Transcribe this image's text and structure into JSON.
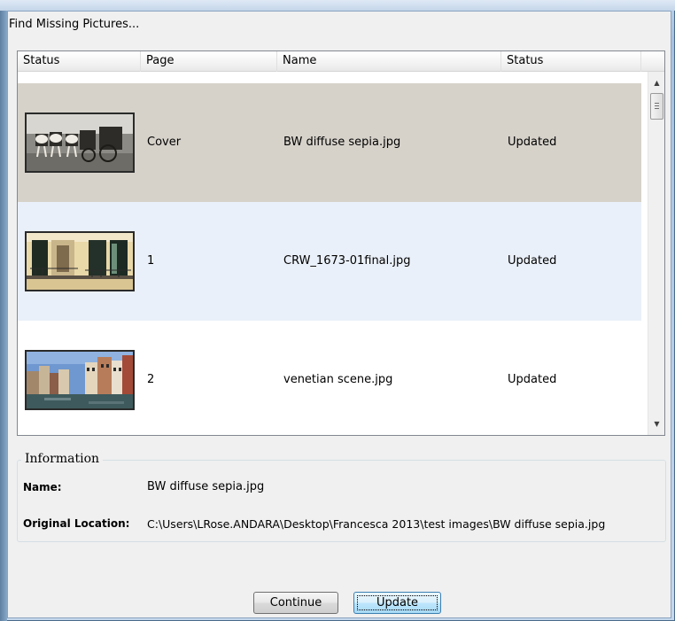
{
  "dialog": {
    "title": "Find Missing Pictures..."
  },
  "columns": [
    "Status",
    "Page",
    "Name",
    "Status"
  ],
  "rows": [
    {
      "page": "Cover",
      "name": "BW diffuse sepia.jpg",
      "status": "Updated",
      "thumb": "sepia-horse-carriage-photo"
    },
    {
      "page": "1",
      "name": "CRW_1673-01final.jpg",
      "status": "Updated",
      "thumb": "balcony-windows-photo"
    },
    {
      "page": "2",
      "name": "venetian scene.jpg",
      "status": "Updated",
      "thumb": "venice-canal-photo"
    }
  ],
  "information": {
    "legend": "Information",
    "name_label": "Name:",
    "name_value": "BW diffuse sepia.jpg",
    "location_label": "Original Location:",
    "location_value": "C:\\Users\\LRose.ANDARA\\Desktop\\Francesca  2013\\test images\\BW diffuse sepia.jpg"
  },
  "buttons": {
    "continue": "Continue",
    "update": "Update"
  },
  "colors": {
    "selected_row": "#d6d2ca",
    "alt_row": "#eaf0f9",
    "default_button_border": "#3c7fb1"
  }
}
